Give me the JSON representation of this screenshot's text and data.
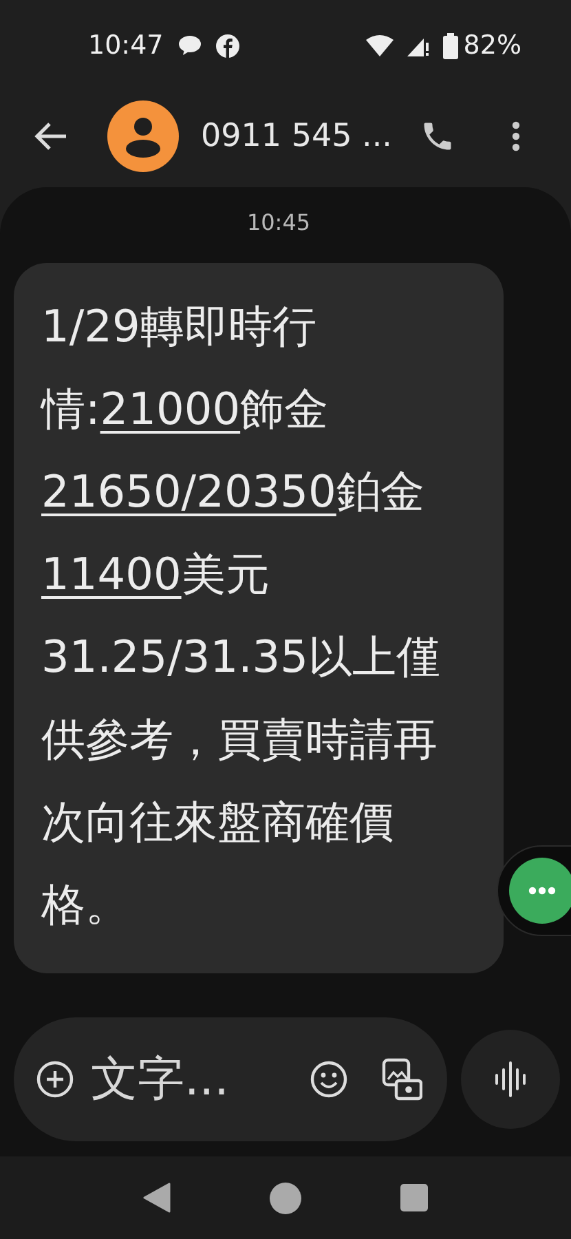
{
  "status_bar": {
    "time": "10:47",
    "battery": "82%"
  },
  "app_bar": {
    "contact": "0911 545 ..."
  },
  "thread": {
    "timestamp": "10:45",
    "message": [
      {
        "kind": "text",
        "text": "1/29轉即時行情:"
      },
      {
        "kind": "link",
        "text": "21000"
      },
      {
        "kind": "text",
        "text": "飾金"
      },
      {
        "kind": "link",
        "text": "21650/20350"
      },
      {
        "kind": "text",
        "text": "鉑金"
      },
      {
        "kind": "link",
        "text": "11400"
      },
      {
        "kind": "text",
        "text": "美元31.25/31.35以上僅供參考，買賣時請再次向往來盤商確價格。"
      }
    ]
  },
  "compose": {
    "placeholder": "文字..."
  }
}
